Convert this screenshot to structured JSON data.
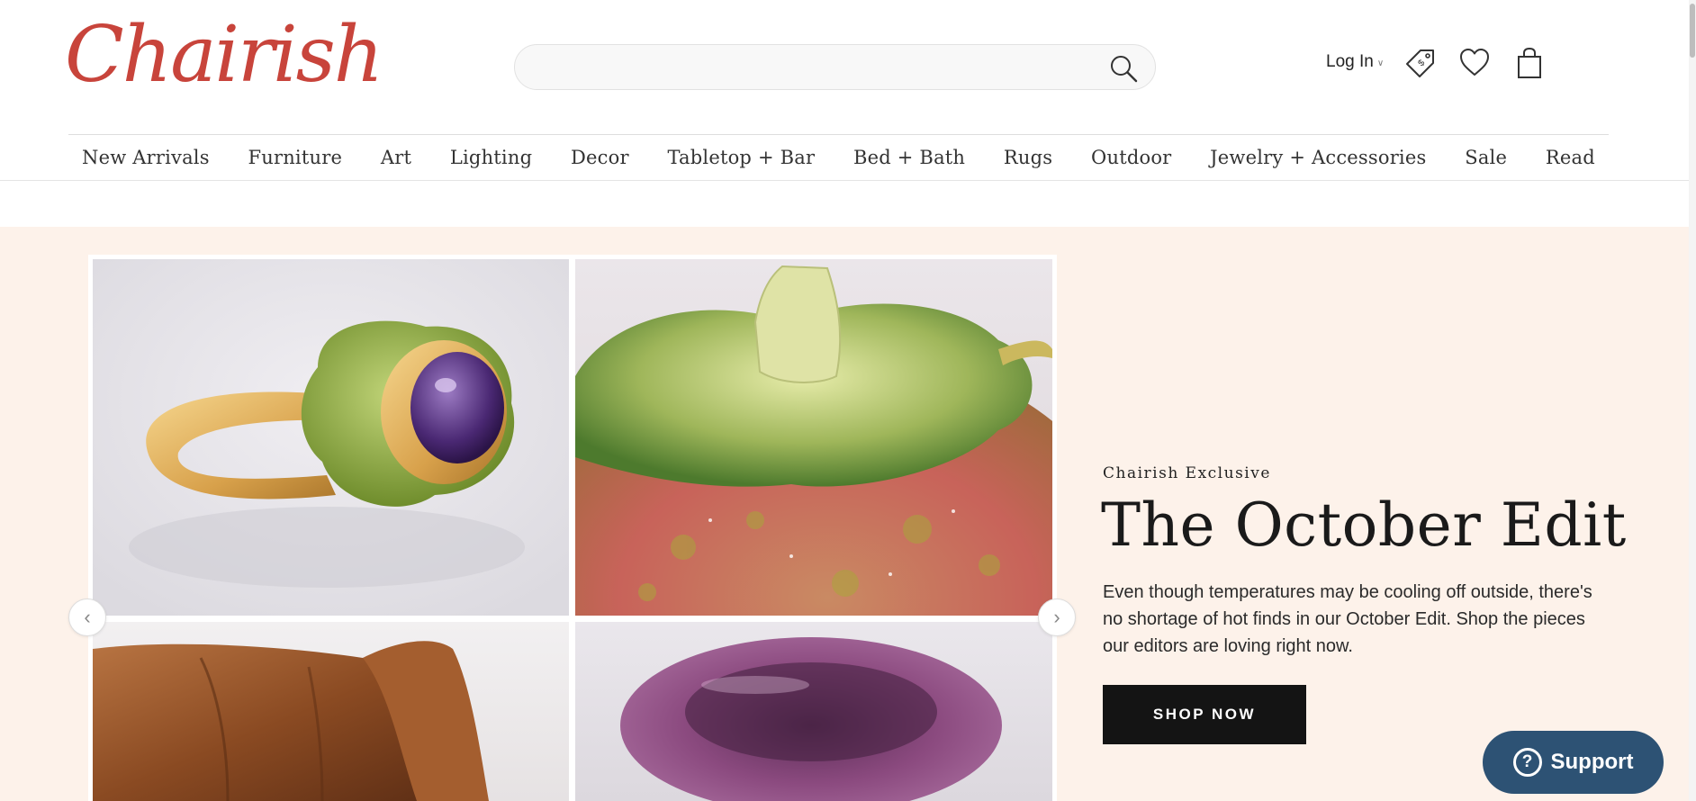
{
  "brand": {
    "logo_text": "Chairish",
    "logo_color": "#c8443b"
  },
  "search": {
    "value": "",
    "placeholder": ""
  },
  "header_actions": {
    "login_label": "Log In"
  },
  "nav": {
    "items": [
      {
        "label": "New Arrivals"
      },
      {
        "label": "Furniture"
      },
      {
        "label": "Art"
      },
      {
        "label": "Lighting"
      },
      {
        "label": "Decor"
      },
      {
        "label": "Tabletop + Bar"
      },
      {
        "label": "Bed + Bath"
      },
      {
        "label": "Rugs"
      },
      {
        "label": "Outdoor"
      },
      {
        "label": "Jewelry + Accessories"
      },
      {
        "label": "Sale"
      },
      {
        "label": "Read"
      }
    ]
  },
  "hero": {
    "kicker": "Chairish Exclusive",
    "title": "The October Edit",
    "body": "Even though temperatures may be cooling off outside, there's no shortage of hot finds in our October Edit. Shop the pieces our editors are loving right now.",
    "cta_label": "SHOP NOW",
    "background": "#fdf2ea",
    "images": [
      "peridot-amethyst-ring",
      "ceramic-pumpkin-tureen",
      "leather-armchair",
      "purple-glass-bowl"
    ]
  },
  "support": {
    "label": "Support",
    "color": "#2d5274"
  },
  "icons": {
    "search": "search-icon",
    "tag": "price-tag-icon",
    "favorites": "heart-icon",
    "cart": "shopping-bag-icon",
    "prev": "chevron-left-icon",
    "next": "chevron-right-icon",
    "help": "question-circle-icon"
  }
}
